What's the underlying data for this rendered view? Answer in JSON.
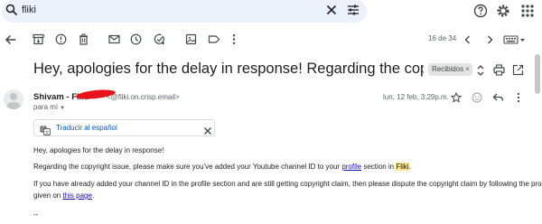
{
  "search": {
    "value": "fliki"
  },
  "toolbar": {
    "pager": "16 de 34"
  },
  "email": {
    "subject": "Hey, apologies for the delay in response! Regarding the copyright issue, ple...",
    "label": "Recibidos",
    "sender_name": "Shivam - Fliki",
    "sender_email": "<@fliki.on.crisp.email>",
    "to": "para mí",
    "date": "lun, 12 feb, 3:29p.m.",
    "translate_label": "Traducir al español",
    "body": {
      "p1": "Hey, apologies for the delay in response!",
      "p2_a": "Regarding the copyright issue, please make sure you've added your Youtube channel ID to your ",
      "p2_link": "profile",
      "p2_b": " section in ",
      "p2_hl": "Fliki",
      "p2_c": ".",
      "p3_line1": "If you have already added your channel ID in the profile section and are still getting copyright claim, then please dispute the copyright claim by following the process",
      "p3_line2_a": "given on ",
      "p3_link": "this page",
      "p3_line2_b": ".",
      "ellipsis": "--"
    }
  },
  "colors": {
    "search_bg": "#eaf1fb",
    "link": "#1a0dab",
    "highlight": "#fde293",
    "redaction": "#e8141c"
  },
  "icons": {
    "search": "search-icon",
    "clear": "close-icon",
    "filter": "tune-icon",
    "help": "help-icon",
    "settings": "gear-icon",
    "apps": "apps-grid-icon"
  }
}
